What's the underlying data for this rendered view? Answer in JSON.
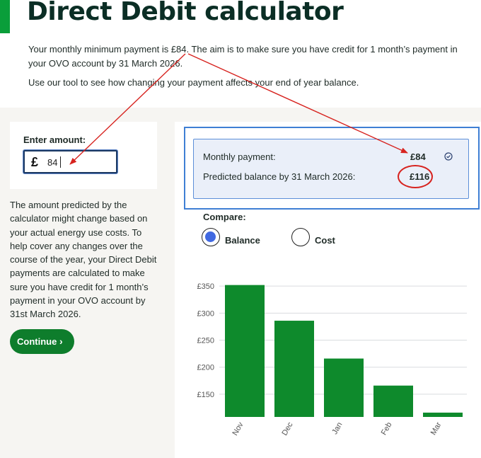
{
  "header": {
    "title": "Direct Debit calculator",
    "intro_1": "Your monthly minimum payment is £84. The aim is to make sure you have credit for 1 month’s payment in your OVO account by 31 March 2026.",
    "intro_2": "Use our tool to see how changing your payment affects your end of year balance."
  },
  "amount_form": {
    "label": "Enter amount:",
    "currency_symbol": "£",
    "value": "84"
  },
  "side_note": "The amount predicted by the calculator might change based on your actual energy use costs. To help cover any changes over the course of the year, your Direct Debit payments are calculated to make sure you have credit for 1 month’s payment in your OVO account by 31st March 2026.",
  "continue_button": {
    "label": "Continue",
    "icon": "chevron-right-icon"
  },
  "summary": {
    "monthly_label": "Monthly payment:",
    "monthly_value": "£84",
    "balance_label": "Predicted balance by 31 March 2026:",
    "balance_value": "£116",
    "icon": "check-circle-icon"
  },
  "compare": {
    "label": "Compare:",
    "options": [
      {
        "label": "Balance",
        "selected": true
      },
      {
        "label": "Cost",
        "selected": false
      }
    ]
  },
  "colors": {
    "brand_green": "#0a9e3a",
    "button_green": "#0e7d2c",
    "bar_green": "#0e8a2c",
    "annotation_red": "#d7231f",
    "annotation_blue": "#3f7fd4",
    "radio_blue": "#4169e1"
  },
  "chart_data": {
    "type": "bar",
    "categories": [
      "Nov",
      "Dec",
      "Jan",
      "Feb",
      "Mar"
    ],
    "values": [
      352,
      286,
      216,
      166,
      116
    ],
    "ylim": [
      108,
      362
    ],
    "yticks": [
      150,
      200,
      250,
      300,
      350
    ],
    "ytick_labels": [
      "£150",
      "£200",
      "£250",
      "£300",
      "£350"
    ],
    "grid": true
  }
}
